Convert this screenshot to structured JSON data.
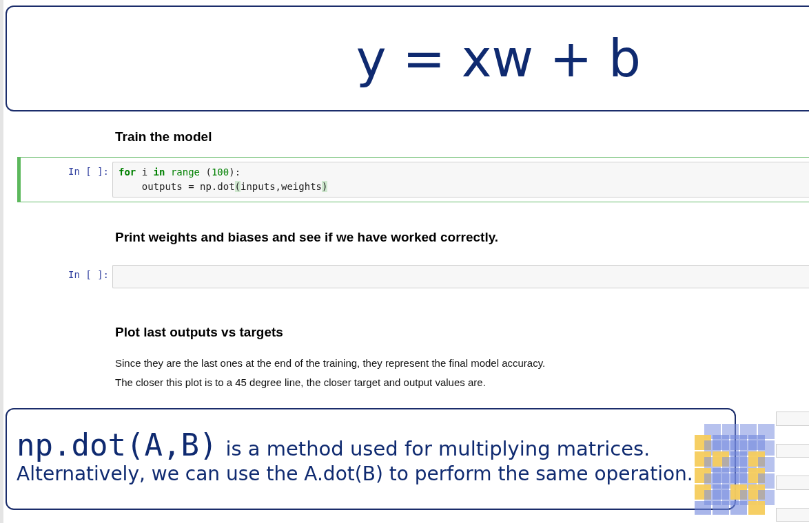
{
  "formula_banner": {
    "text": "y = xw + b"
  },
  "cells": [
    {
      "kind": "heading",
      "text": "Train the model"
    },
    {
      "kind": "code",
      "prompt": "In [ ]:",
      "selected": true,
      "lines": [
        [
          {
            "t": "for",
            "kind": "keyword"
          },
          {
            "t": " i ",
            "kind": "plain"
          },
          {
            "t": "in ",
            "kind": "keyword"
          },
          {
            "t": "range",
            "kind": "builtin"
          },
          {
            "t": " (",
            "kind": "plain"
          },
          {
            "t": "100",
            "kind": "number"
          },
          {
            "t": "):",
            "kind": "plain"
          }
        ],
        [
          {
            "t": "    outputs = np.dot",
            "kind": "plain"
          },
          {
            "t": "(",
            "kind": "bracket"
          },
          {
            "t": "inputs,weights",
            "kind": "plain"
          },
          {
            "t": ")",
            "kind": "bracket"
          }
        ]
      ]
    },
    {
      "kind": "heading",
      "text": "Print weights and biases and see if we have worked correctly."
    },
    {
      "kind": "code",
      "prompt": "In [ ]:",
      "selected": false
    },
    {
      "kind": "heading",
      "text": "Plot last outputs vs targets"
    },
    {
      "kind": "paragraph",
      "lines": [
        "Since they are the last ones at the end of the training, they represent the final model accuracy.",
        "The closer this plot is to a 45 degree line, the closer target and output values are."
      ]
    }
  ],
  "note_banner": {
    "code": "np.dot(A,B)",
    "line_1": "is a method used for multiplying matrices.",
    "line_2": "Alternatively, we can use the A.dot(B) to perform the same operation."
  }
}
